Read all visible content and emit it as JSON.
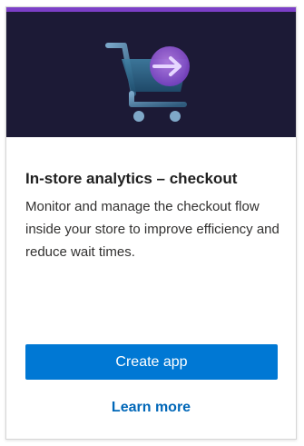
{
  "card": {
    "title": "In-store analytics – checkout",
    "description": "Monitor and manage the checkout flow inside your store to improve efficiency and reduce wait times.",
    "create_button_label": "Create app",
    "learn_more_label": "Learn more",
    "hero_icon": "shopping-cart-arrow-icon"
  },
  "colors": {
    "header_background": "#1c1a36",
    "header_accent": "#7c3fc7",
    "primary_button": "#0078d4",
    "link": "#0067b8"
  }
}
